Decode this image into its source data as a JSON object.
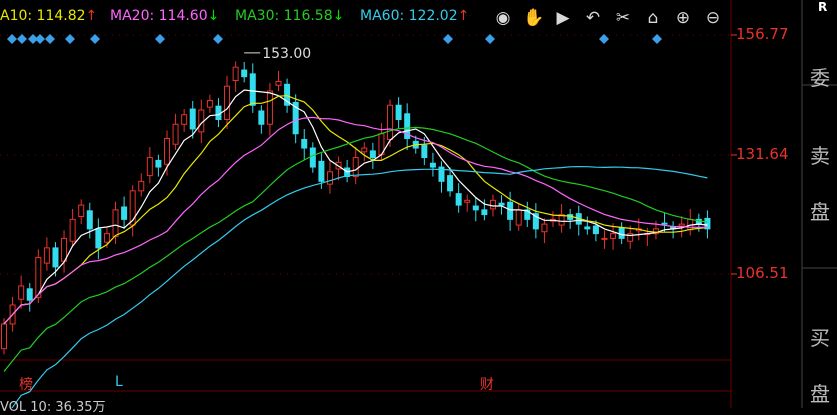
{
  "ma_legend": [
    {
      "label": "A10: 114.82",
      "arrow": "↑",
      "color": "#e8e800",
      "arrow_color": "#e8322b"
    },
    {
      "label": "MA20: 114.60",
      "arrow": "↓",
      "color": "#ff66ff",
      "arrow_color": "#00dd00"
    },
    {
      "label": "MA30: 116.58",
      "arrow": "↓",
      "color": "#22cc22",
      "arrow_color": "#00dd00"
    },
    {
      "label": "MA60: 122.02",
      "arrow": "↑",
      "color": "#33ccee",
      "arrow_color": "#e8322b"
    }
  ],
  "toolbar": [
    {
      "icon": "eye-icon",
      "glyph": "◉"
    },
    {
      "icon": "hand-icon",
      "glyph": "✋"
    },
    {
      "icon": "play-icon",
      "glyph": "▶"
    },
    {
      "icon": "undo-icon",
      "glyph": "↶"
    },
    {
      "icon": "scissors-icon",
      "glyph": "✂"
    },
    {
      "icon": "lock-icon",
      "glyph": "⌂"
    },
    {
      "icon": "zoom-in-icon",
      "glyph": "⊕"
    },
    {
      "icon": "zoom-out-icon",
      "glyph": "⊖"
    }
  ],
  "price_axis": [
    "156.77",
    "131.64",
    "106.51"
  ],
  "peak_label": "153.00",
  "side_labels": {
    "r": "R",
    "wei": "委",
    "mai": "卖",
    "pan1": "盘",
    "buy": "买",
    "pan2": "盘"
  },
  "markers": [
    {
      "text": "榜",
      "color": "#e8322b"
    },
    {
      "text": "L",
      "color": "#33ccee"
    },
    {
      "text": "财",
      "color": "#e8322b"
    }
  ],
  "volume_label": "VOL 10: 36.35万",
  "colors": {
    "up": "#e8322b",
    "down": "#33ddee",
    "grid": "#6a0000",
    "ma5": "#ffffff"
  }
}
